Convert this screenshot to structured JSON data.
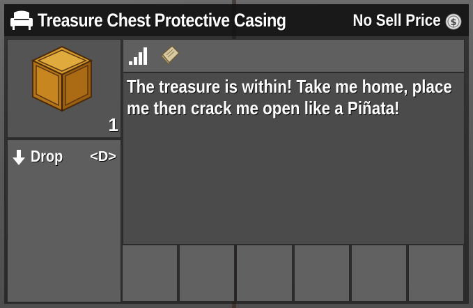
{
  "header": {
    "title": "Treasure Chest Protective Casing",
    "price_label": "No Sell Price",
    "header_icon": "armchair-icon",
    "price_icon": "coin-icon"
  },
  "item": {
    "icon": "wooden-crate-icon",
    "count": "1"
  },
  "actions": [
    {
      "icon": "down-arrow-icon",
      "label": "Drop",
      "key": "<D>"
    }
  ],
  "stats": {
    "icons": [
      "signal-bars-icon",
      "book-icon"
    ]
  },
  "description": "The treasure is within! Take me home, place me then crack me open like a Piñata!",
  "mod_slots": [
    {},
    {},
    {},
    {},
    {},
    {}
  ],
  "colors": {
    "panel_dark": "#141414",
    "panel": "#545454",
    "text": "#ffffff",
    "crate": "#b87a1e",
    "book": "#d8c9a0"
  }
}
